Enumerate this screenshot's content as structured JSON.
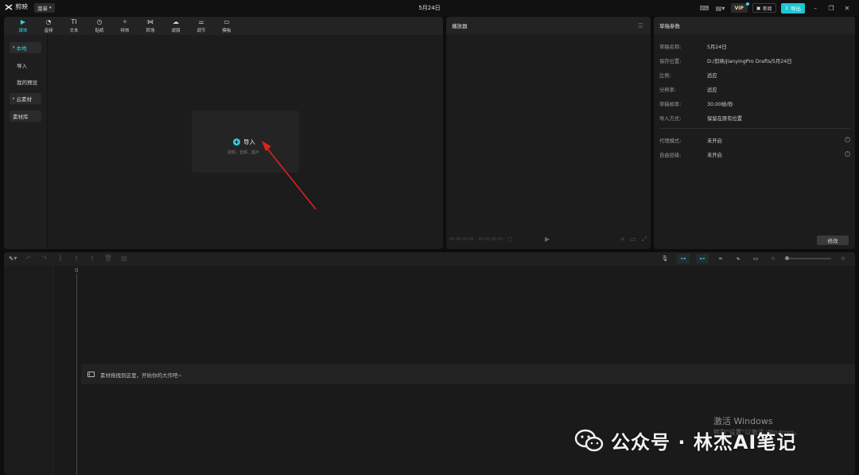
{
  "titlebar": {
    "app_name": "剪映",
    "menu_label": "菜单",
    "project_title": "5月24日",
    "vip": "VIP",
    "review": "审阅",
    "export": "导出"
  },
  "media_tabs": [
    {
      "label": "媒体",
      "icon": "media-icon",
      "active": true
    },
    {
      "label": "音频",
      "icon": "audio-icon"
    },
    {
      "label": "文本",
      "icon": "text-icon"
    },
    {
      "label": "贴纸",
      "icon": "sticker-icon"
    },
    {
      "label": "特效",
      "icon": "effects-icon"
    },
    {
      "label": "转场",
      "icon": "transition-icon"
    },
    {
      "label": "滤镜",
      "icon": "filter-icon"
    },
    {
      "label": "调节",
      "icon": "adjust-icon"
    },
    {
      "label": "模板",
      "icon": "template-icon"
    }
  ],
  "media_sidebar": {
    "local": "本地",
    "import": "导入",
    "my_presets": "我的预设",
    "cloud": "云素材",
    "library": "素材库"
  },
  "import_zone": {
    "button": "导入",
    "hint": "视频、音频、图片"
  },
  "player": {
    "title": "播放器",
    "time_current": "00:00:00:00",
    "time_total": "00:00:00:00"
  },
  "params": {
    "title": "草稿参数",
    "rows": [
      {
        "key": "草稿名称:",
        "value": "5月24日"
      },
      {
        "key": "保存位置:",
        "value": "D:/剪映/JianyingPro Drafts/5月24日"
      },
      {
        "key": "比例:",
        "value": "适应"
      },
      {
        "key": "分辨率:",
        "value": "适应"
      },
      {
        "key": "草稿帧率:",
        "value": "30.00帧/秒"
      },
      {
        "key": "导入方式:",
        "value": "保留在原有位置"
      }
    ],
    "proxy_key": "代理模式:",
    "proxy_value": "未开启",
    "free_layer_key": "自由层级:",
    "free_layer_value": "未开启",
    "modify": "修改"
  },
  "timeline": {
    "ruler_zero": "0",
    "drop_hint": "素材拖拽到这里，开始你的大作吧~"
  },
  "overlay": {
    "activate_title": "激活 Windows",
    "activate_sub": "转到\"设置\"以激活 Windows。",
    "watermark": "公众号 · 林杰AI笔记"
  }
}
